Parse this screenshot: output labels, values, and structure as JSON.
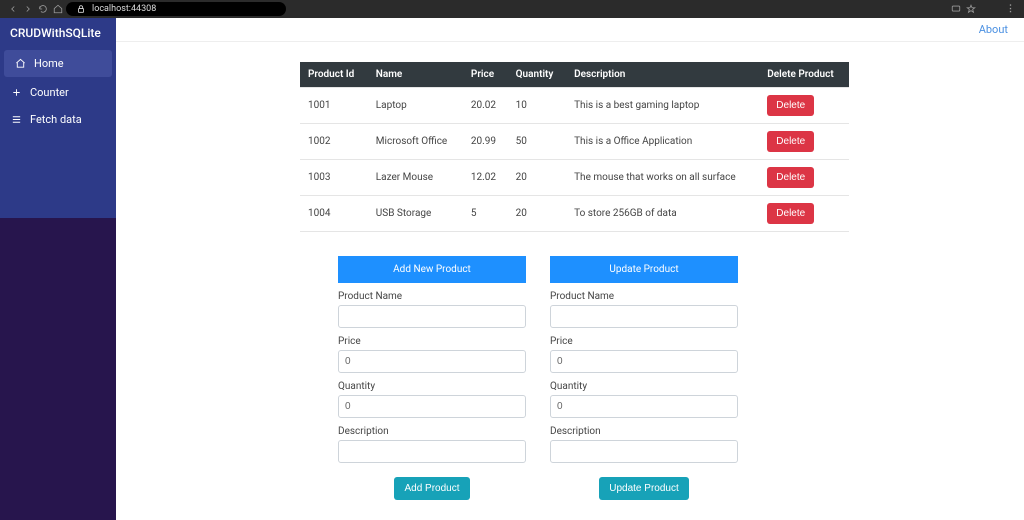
{
  "browser": {
    "url": "localhost:44308",
    "ext_colors": [
      "#d32f2f",
      "#616161",
      "#ef6c00",
      "#303030",
      "#43a047",
      "#7cb342",
      "#ff9800",
      "#388e3c",
      "#1976d2",
      "#039be5",
      "#7e57c2",
      "#8d6e63"
    ]
  },
  "brand": "CRUDWithSQLite",
  "nav": [
    {
      "label": "Home",
      "icon": "home",
      "active": true
    },
    {
      "label": "Counter",
      "icon": "plus",
      "active": false
    },
    {
      "label": "Fetch data",
      "icon": "list",
      "active": false
    }
  ],
  "topnav": {
    "about": "About"
  },
  "table": {
    "headers": [
      "Product Id",
      "Name",
      "Price",
      "Quantity",
      "Description",
      "Delete Product"
    ],
    "rows": [
      {
        "id": "1001",
        "name": "Laptop",
        "price": "20.02",
        "qty": "10",
        "desc": "This is a best gaming laptop"
      },
      {
        "id": "1002",
        "name": "Microsoft Office",
        "price": "20.99",
        "qty": "50",
        "desc": "This is a Office Application"
      },
      {
        "id": "1003",
        "name": "Lazer Mouse",
        "price": "12.02",
        "qty": "20",
        "desc": "The mouse that works on all surface"
      },
      {
        "id": "1004",
        "name": "USB Storage",
        "price": "5",
        "qty": "20",
        "desc": "To store 256GB of data"
      }
    ],
    "delete_label": "Delete"
  },
  "add_form": {
    "title": "Add New Product",
    "fields": {
      "name_label": "Product Name",
      "name_value": "",
      "price_label": "Price",
      "price_value": "0",
      "qty_label": "Quantity",
      "qty_value": "0",
      "desc_label": "Description",
      "desc_value": ""
    },
    "submit": "Add Product"
  },
  "update_form": {
    "title": "Update Product",
    "fields": {
      "name_label": "Product Name",
      "name_value": "",
      "price_label": "Price",
      "price_value": "0",
      "qty_label": "Quantity",
      "qty_value": "0",
      "desc_label": "Description",
      "desc_value": ""
    },
    "submit": "Update Product"
  }
}
